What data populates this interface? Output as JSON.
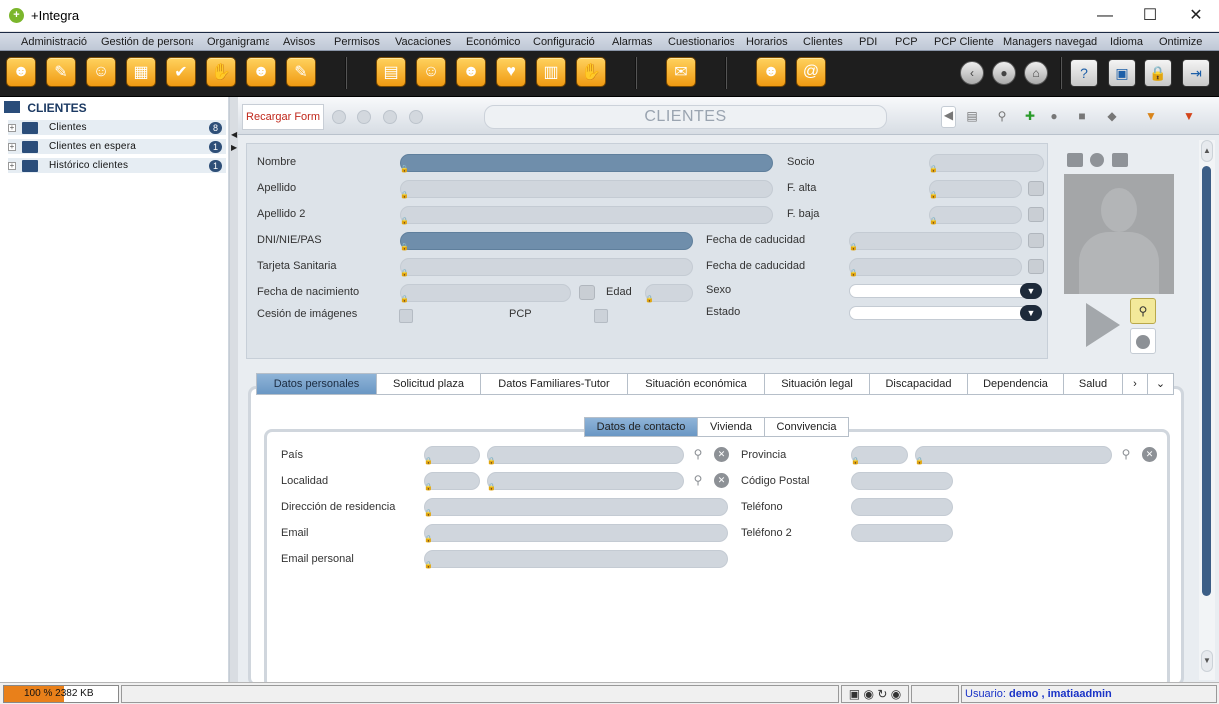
{
  "window": {
    "title": "+Integra",
    "minimize": "—",
    "maximize": "☐",
    "close": "✕"
  },
  "menu": [
    "Administració",
    "Gestión de persona",
    "Organigrama",
    "Avisos",
    "Permisos",
    "Vacaciones",
    "Económico",
    "Configuració",
    "Alarmas",
    "Cuestionarios",
    "Horarios",
    "Clientes",
    "PDI",
    "PCP",
    "PCP Cliente",
    "Managers navegad",
    "Idioma",
    "Ontimize"
  ],
  "toolbar_icons": [
    "users-icon",
    "notepad-icon",
    "contact-icon",
    "keyboard-icon",
    "checklist-icon",
    "handshake-icon",
    "group-icon",
    "edit-icon",
    "calendar-icon",
    "person-icon",
    "worker-icon",
    "couple-icon",
    "schedule-icon",
    "agreement-icon",
    "mail-icon",
    "support-icon",
    "at-icon"
  ],
  "sidebar": {
    "root": "CLIENTES",
    "items": [
      {
        "label": "Clientes",
        "count": "8"
      },
      {
        "label": "Clientes en espera",
        "count": "1"
      },
      {
        "label": "Histórico clientes",
        "count": "1"
      }
    ]
  },
  "form": {
    "reload": "Recargar Form",
    "title": "CLIENTES",
    "labels": {
      "nombre": "Nombre",
      "apellido": "Apellido",
      "apellido2": "Apellido 2",
      "dni": "DNI/NIE/PAS",
      "tarjeta": "Tarjeta Sanitaria",
      "nacimiento": "Fecha de nacimiento",
      "edad": "Edad",
      "cesion": "Cesión de imágenes",
      "pcp": "PCP",
      "socio": "Socio",
      "falta": "F. alta",
      "fbaja": "F. baja",
      "caducidad1": "Fecha de caducidad",
      "caducidad2": "Fecha de caducidad",
      "sexo": "Sexo",
      "estado": "Estado"
    }
  },
  "tabs": [
    "Datos personales",
    "Solicitud plaza",
    "Datos Familiares-Tutor",
    "Situación económica",
    "Situación legal",
    "Discapacidad",
    "Dependencia",
    "Salud"
  ],
  "subtabs": [
    "Datos de contacto",
    "Vivienda",
    "Convivencia"
  ],
  "contact": {
    "pais": "País",
    "localidad": "Localidad",
    "direccion": "Dirección de residencia",
    "email": "Email",
    "email_personal": "Email personal",
    "provincia": "Provincia",
    "cp": "Código Postal",
    "telefono": "Teléfono",
    "telefono2": "Teléfono 2"
  },
  "status": {
    "memory": "100 %  2382 KB",
    "memory_fraction": 1.0,
    "user_label": "Usuario:",
    "user_name": "demo",
    "user_sep": ",",
    "user_login": "imatiaadmin"
  },
  "colors": {
    "accent": "#6a97c4",
    "toolbar": "#1e1e1e",
    "progress": "#e9801a",
    "reload": "#c0271b"
  }
}
